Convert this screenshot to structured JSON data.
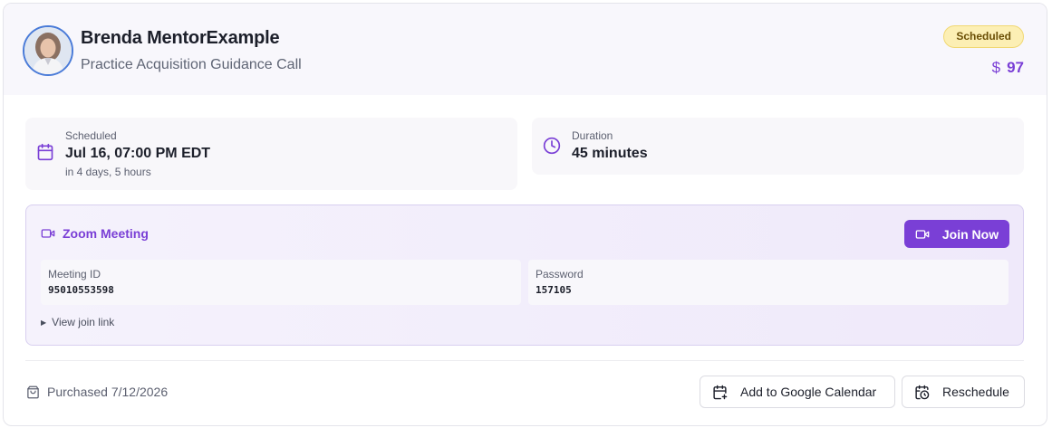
{
  "booking": {
    "mentor_name": "Brenda MentorExample",
    "session_title": "Practice Acquisition Guidance Call",
    "status": "Scheduled",
    "price_symbol": "$",
    "price": "97"
  },
  "schedule": {
    "label": "Scheduled",
    "value": "Jul 16, 07:00 PM EDT",
    "relative": "in 4 days, 5 hours"
  },
  "duration": {
    "label": "Duration",
    "value": "45 minutes"
  },
  "zoom": {
    "title": "Zoom Meeting",
    "join_label": "Join Now",
    "meeting_id_label": "Meeting ID",
    "meeting_id": "95010553598",
    "password_label": "Password",
    "password": "157105",
    "join_link_label": "View join link"
  },
  "footer": {
    "purchased": "Purchased 7/12/2026",
    "gcal_label": "Add to Google Calendar",
    "reschedule_label": "Reschedule"
  },
  "icons": {
    "calendar": "calendar-icon",
    "clock": "clock-icon",
    "video": "video-camera-icon",
    "bag": "shopping-bag-icon",
    "calendar_plus": "calendar-plus-icon",
    "calendar_clock": "calendar-clock-icon"
  },
  "colors": {
    "accent": "#7a3fd6",
    "status_bg": "#fcefb4",
    "status_text": "#6b4f06"
  }
}
